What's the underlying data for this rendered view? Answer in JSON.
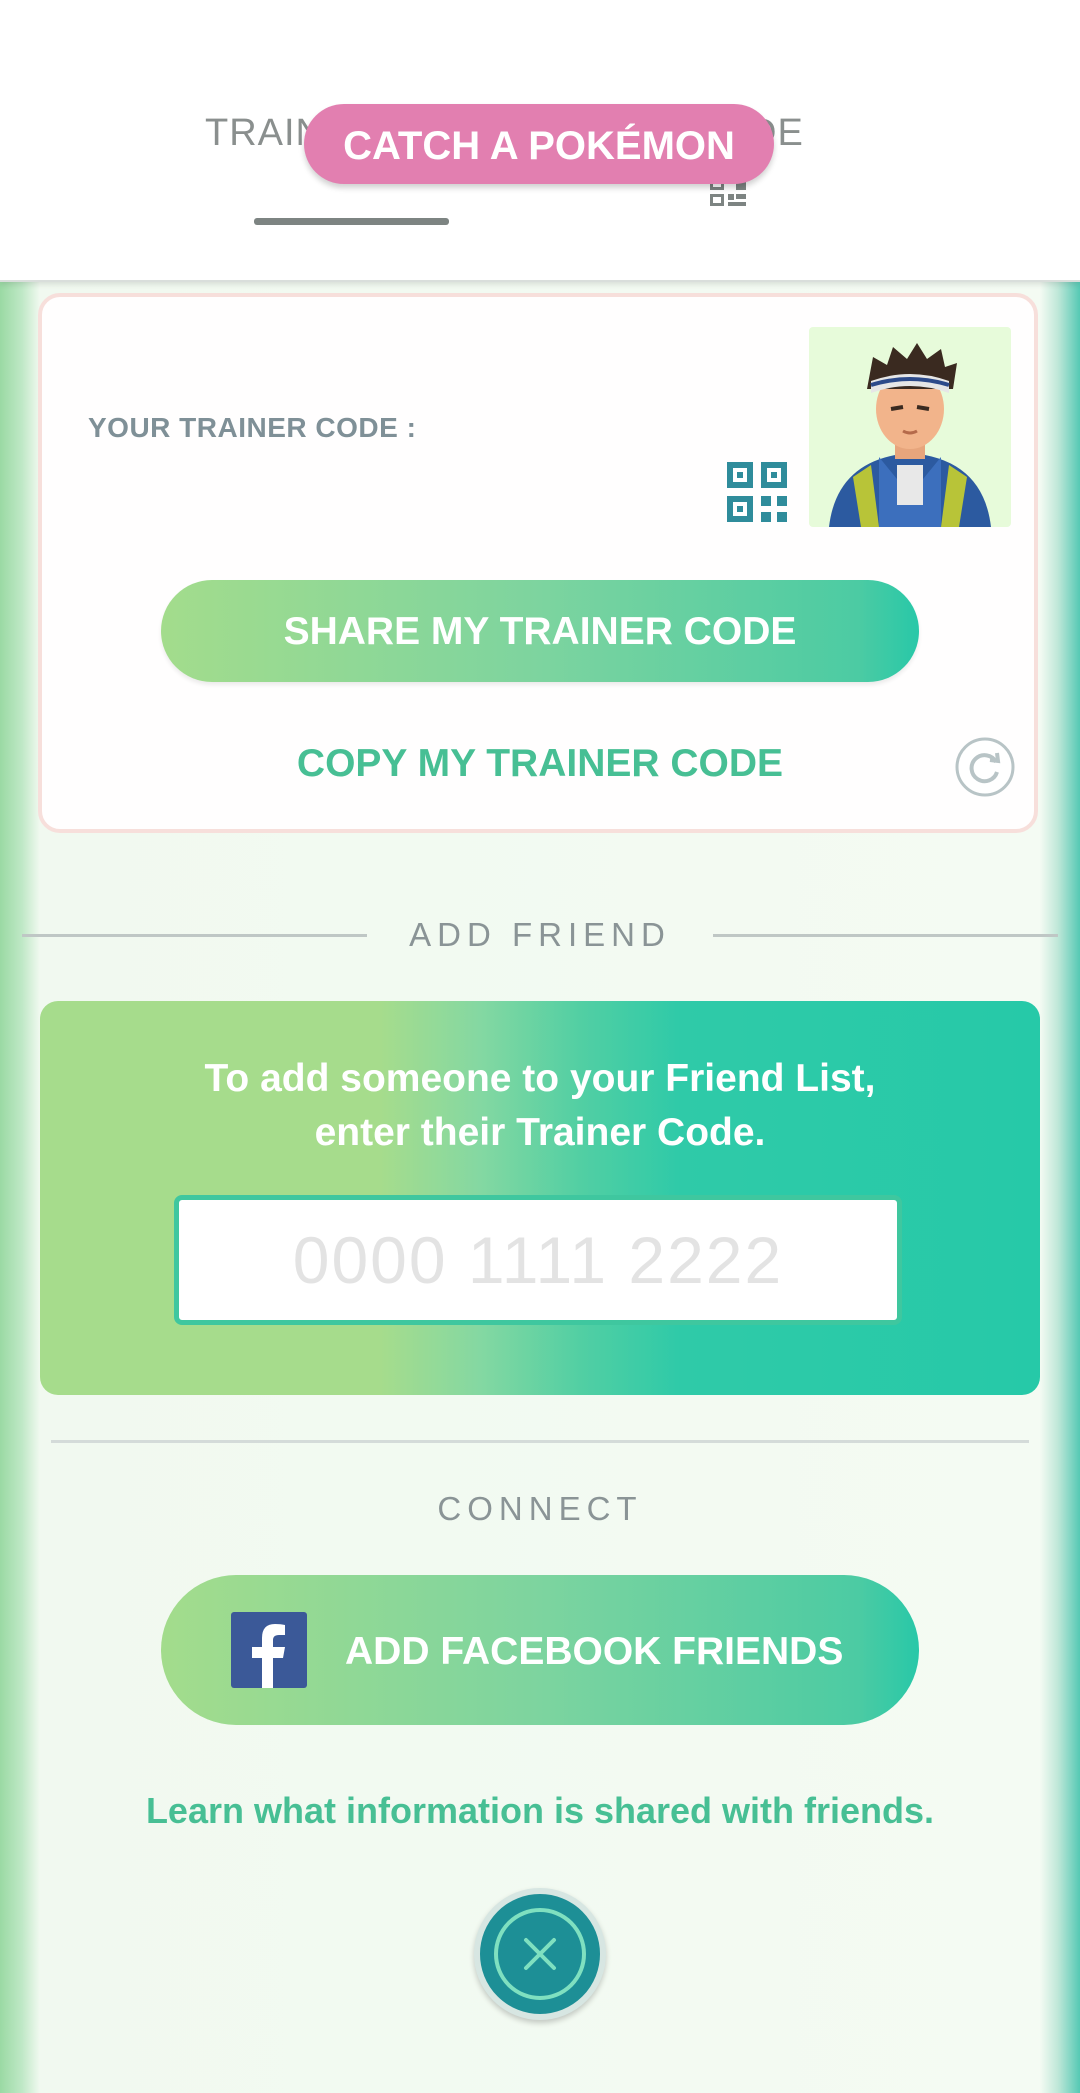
{
  "header": {
    "tab_trainer": "TRAINER",
    "tab_code": "CODE",
    "catch_pill": "CATCH A POKÉMON"
  },
  "trainer_card": {
    "code_label": "YOUR TRAINER CODE :",
    "share_button": "SHARE MY TRAINER CODE",
    "copy_link": "COPY MY TRAINER CODE"
  },
  "add_friend": {
    "section_title": "ADD FRIEND",
    "instruction": "To add someone to your Friend List, enter their Trainer Code.",
    "input_placeholder": "0000 1111 2222",
    "input_value": ""
  },
  "connect": {
    "section_title": "CONNECT",
    "facebook_button": "ADD FACEBOOK FRIENDS",
    "learn_link": "Learn what information is shared with friends."
  },
  "icons": {
    "qr": "qr-code-icon",
    "refresh": "refresh-icon",
    "facebook": "facebook-icon",
    "close": "close-icon"
  },
  "colors": {
    "accent_green": "#47bf94",
    "catch_pink": "#e27fb0",
    "facebook_blue": "#3b5998",
    "close_teal": "#1d8f96"
  }
}
